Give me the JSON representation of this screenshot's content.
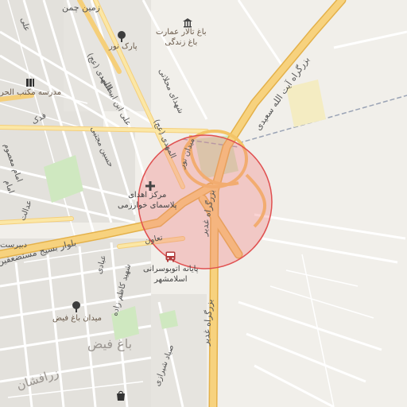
{
  "colors": {
    "background": "#f1efea",
    "block": "#e3e1dc",
    "major_road": "#f7d27e",
    "major_road_casing": "#e4b14a",
    "secondary_road": "#fbe7a6",
    "minor_road": "#ffffff",
    "park": "#cfe8c0",
    "radius_fill": "#f08080",
    "radius_stroke": "#e05050",
    "boundary_dash": "#9aa3b5"
  },
  "map": {
    "highlight_shape": "circle",
    "icons": [
      "landmark-icon",
      "tree-icon",
      "school-icon",
      "hospital-cross-icon",
      "bus-icon",
      "tree-icon",
      "shop-icon"
    ]
  },
  "labels": {
    "zamin_chaman": "زمین چمن",
    "ali": "علی",
    "bagh_talar_line1": "باغ تالار عمارت",
    "bagh_talar_line2": "باغ زندگی",
    "park_noor": "پارک نور",
    "madrese": "مدرسه مکتب الحر",
    "almahdi_top": "المهدی (عج)",
    "shahid_mahallati": "شهدای محلاتی",
    "boulevard_ayatollah": "بزرگراه آیت الله سعیدی",
    "ali_ibn_abitaleb": "علی ابن ابیطالب",
    "almahdi_mid": "المهدی (عج)",
    "fadak": "فدک",
    "hosein_mojtaba": "حسین مجتبی",
    "meydan_noor": "میدان نور",
    "imam_masoum": "امام معصوم",
    "imam": "امام",
    "markaz_line1": "مرکز اهدای",
    "markaz_line2": "پلاسمای خوارزمی",
    "bozorgrah_ghadir_1": "بزرگراه غدیر",
    "edalat": "عدالت",
    "bolvar_basij": "بلوار بسیج مستضعفین",
    "dabirestan": "دبیرست",
    "taavon": "تعاون",
    "payaneh_line1": "پایانه اتوبوسرانی",
    "payaneh_line2": "اسلامشهر",
    "shahid_kazemzadeh": "شهید کاظم زاده",
    "ebadi": "عبادی",
    "bozorgrah_ghadir_2": "بزرگراه غدیر",
    "meydan_bagh_feyz": "میدان باغ فیض",
    "bagh_feyz": "باغ فیض",
    "shahid_shahriari": "صیاد شیرازی",
    "zarafshan": "زرافشان"
  }
}
